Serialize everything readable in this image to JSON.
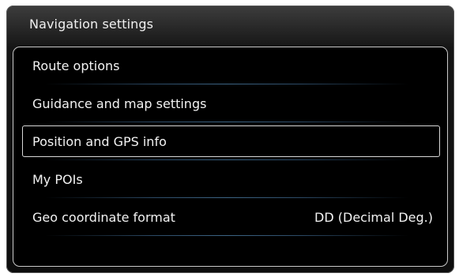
{
  "header": {
    "title": "Navigation settings"
  },
  "menu": {
    "items": [
      {
        "label": "Route options",
        "value": "",
        "selected": false
      },
      {
        "label": "Guidance and map settings",
        "value": "",
        "selected": false
      },
      {
        "label": "Position and GPS info",
        "value": "",
        "selected": true
      },
      {
        "label": "My POIs",
        "value": "",
        "selected": false
      },
      {
        "label": "Geo coordinate format",
        "value": "DD (Decimal Deg.)",
        "selected": false
      }
    ]
  },
  "colors": {
    "background": "#0d0d0d",
    "text": "#f2f2f2",
    "separator": "#3d6585",
    "selection_border": "#d8d8d8"
  }
}
